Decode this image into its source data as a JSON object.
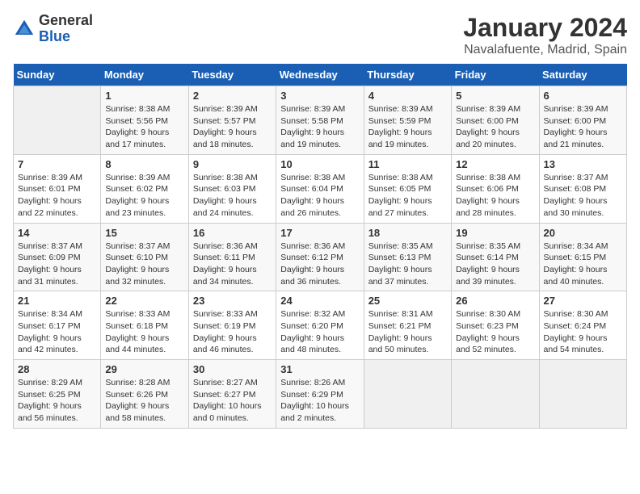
{
  "header": {
    "logo_line1": "General",
    "logo_line2": "Blue",
    "month_title": "January 2024",
    "location": "Navalafuente, Madrid, Spain"
  },
  "days_of_week": [
    "Sunday",
    "Monday",
    "Tuesday",
    "Wednesday",
    "Thursday",
    "Friday",
    "Saturday"
  ],
  "weeks": [
    [
      {
        "day": "",
        "info": ""
      },
      {
        "day": "1",
        "info": "Sunrise: 8:38 AM\nSunset: 5:56 PM\nDaylight: 9 hours\nand 17 minutes."
      },
      {
        "day": "2",
        "info": "Sunrise: 8:39 AM\nSunset: 5:57 PM\nDaylight: 9 hours\nand 18 minutes."
      },
      {
        "day": "3",
        "info": "Sunrise: 8:39 AM\nSunset: 5:58 PM\nDaylight: 9 hours\nand 19 minutes."
      },
      {
        "day": "4",
        "info": "Sunrise: 8:39 AM\nSunset: 5:59 PM\nDaylight: 9 hours\nand 19 minutes."
      },
      {
        "day": "5",
        "info": "Sunrise: 8:39 AM\nSunset: 6:00 PM\nDaylight: 9 hours\nand 20 minutes."
      },
      {
        "day": "6",
        "info": "Sunrise: 8:39 AM\nSunset: 6:00 PM\nDaylight: 9 hours\nand 21 minutes."
      }
    ],
    [
      {
        "day": "7",
        "info": "Sunrise: 8:39 AM\nSunset: 6:01 PM\nDaylight: 9 hours\nand 22 minutes."
      },
      {
        "day": "8",
        "info": "Sunrise: 8:39 AM\nSunset: 6:02 PM\nDaylight: 9 hours\nand 23 minutes."
      },
      {
        "day": "9",
        "info": "Sunrise: 8:38 AM\nSunset: 6:03 PM\nDaylight: 9 hours\nand 24 minutes."
      },
      {
        "day": "10",
        "info": "Sunrise: 8:38 AM\nSunset: 6:04 PM\nDaylight: 9 hours\nand 26 minutes."
      },
      {
        "day": "11",
        "info": "Sunrise: 8:38 AM\nSunset: 6:05 PM\nDaylight: 9 hours\nand 27 minutes."
      },
      {
        "day": "12",
        "info": "Sunrise: 8:38 AM\nSunset: 6:06 PM\nDaylight: 9 hours\nand 28 minutes."
      },
      {
        "day": "13",
        "info": "Sunrise: 8:37 AM\nSunset: 6:08 PM\nDaylight: 9 hours\nand 30 minutes."
      }
    ],
    [
      {
        "day": "14",
        "info": "Sunrise: 8:37 AM\nSunset: 6:09 PM\nDaylight: 9 hours\nand 31 minutes."
      },
      {
        "day": "15",
        "info": "Sunrise: 8:37 AM\nSunset: 6:10 PM\nDaylight: 9 hours\nand 32 minutes."
      },
      {
        "day": "16",
        "info": "Sunrise: 8:36 AM\nSunset: 6:11 PM\nDaylight: 9 hours\nand 34 minutes."
      },
      {
        "day": "17",
        "info": "Sunrise: 8:36 AM\nSunset: 6:12 PM\nDaylight: 9 hours\nand 36 minutes."
      },
      {
        "day": "18",
        "info": "Sunrise: 8:35 AM\nSunset: 6:13 PM\nDaylight: 9 hours\nand 37 minutes."
      },
      {
        "day": "19",
        "info": "Sunrise: 8:35 AM\nSunset: 6:14 PM\nDaylight: 9 hours\nand 39 minutes."
      },
      {
        "day": "20",
        "info": "Sunrise: 8:34 AM\nSunset: 6:15 PM\nDaylight: 9 hours\nand 40 minutes."
      }
    ],
    [
      {
        "day": "21",
        "info": "Sunrise: 8:34 AM\nSunset: 6:17 PM\nDaylight: 9 hours\nand 42 minutes."
      },
      {
        "day": "22",
        "info": "Sunrise: 8:33 AM\nSunset: 6:18 PM\nDaylight: 9 hours\nand 44 minutes."
      },
      {
        "day": "23",
        "info": "Sunrise: 8:33 AM\nSunset: 6:19 PM\nDaylight: 9 hours\nand 46 minutes."
      },
      {
        "day": "24",
        "info": "Sunrise: 8:32 AM\nSunset: 6:20 PM\nDaylight: 9 hours\nand 48 minutes."
      },
      {
        "day": "25",
        "info": "Sunrise: 8:31 AM\nSunset: 6:21 PM\nDaylight: 9 hours\nand 50 minutes."
      },
      {
        "day": "26",
        "info": "Sunrise: 8:30 AM\nSunset: 6:23 PM\nDaylight: 9 hours\nand 52 minutes."
      },
      {
        "day": "27",
        "info": "Sunrise: 8:30 AM\nSunset: 6:24 PM\nDaylight: 9 hours\nand 54 minutes."
      }
    ],
    [
      {
        "day": "28",
        "info": "Sunrise: 8:29 AM\nSunset: 6:25 PM\nDaylight: 9 hours\nand 56 minutes."
      },
      {
        "day": "29",
        "info": "Sunrise: 8:28 AM\nSunset: 6:26 PM\nDaylight: 9 hours\nand 58 minutes."
      },
      {
        "day": "30",
        "info": "Sunrise: 8:27 AM\nSunset: 6:27 PM\nDaylight: 10 hours\nand 0 minutes."
      },
      {
        "day": "31",
        "info": "Sunrise: 8:26 AM\nSunset: 6:29 PM\nDaylight: 10 hours\nand 2 minutes."
      },
      {
        "day": "",
        "info": ""
      },
      {
        "day": "",
        "info": ""
      },
      {
        "day": "",
        "info": ""
      }
    ]
  ]
}
